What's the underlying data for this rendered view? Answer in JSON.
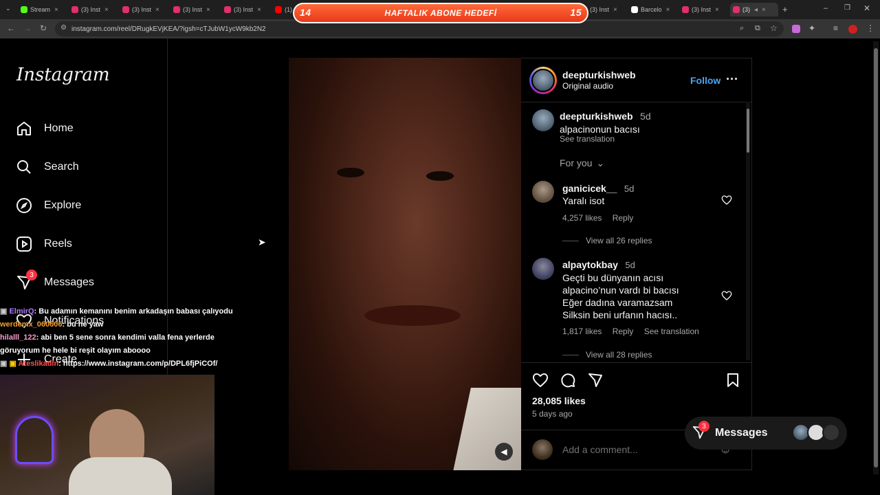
{
  "browser": {
    "tabs": [
      {
        "label": "Stream",
        "color": "#53fc18"
      },
      {
        "label": "(3) Inst",
        "color": "#e1306c"
      },
      {
        "label": "(3) Inst",
        "color": "#e1306c"
      },
      {
        "label": "(3) Inst",
        "color": "#e1306c"
      },
      {
        "label": "(3) Inst",
        "color": "#e1306c"
      },
      {
        "label": "(1)",
        "color": "#ff0000"
      },
      {
        "label": "(3) Inst",
        "color": "#e1306c"
      },
      {
        "label": "Barcelo",
        "color": "#ffffff"
      },
      {
        "label": "(3) Inst",
        "color": "#e1306c"
      },
      {
        "label": "(3)",
        "color": "#e1306c"
      }
    ],
    "url": "instagram.com/reel/DRugkEVjKEA/?igsh=cTJubW1ycW9kb2N2"
  },
  "banner": {
    "left_num": "14",
    "text": "HAFTALIK ABONE HEDEFİ",
    "right_num": "15"
  },
  "instagram": {
    "logo": "Instagram",
    "nav": {
      "home": "Home",
      "search": "Search",
      "explore": "Explore",
      "reels": "Reels",
      "messages": "Messages",
      "messages_badge": "3",
      "notifications": "Notifications",
      "create": "Create"
    },
    "post": {
      "author": "deepturkishweb",
      "audio": "Original audio",
      "follow": "Follow",
      "caption": {
        "user": "deepturkishweb",
        "time": "5d",
        "text": "alpacinonun bacısı",
        "translate": "See translation"
      },
      "filter": "For you",
      "comments": [
        {
          "user": "ganicicek__",
          "time": "5d",
          "lines": [
            "Yaralı isot"
          ],
          "likes": "4,257 likes",
          "reply": "Reply",
          "replies": "View all 26 replies"
        },
        {
          "user": "alpaytokbay",
          "time": "5d",
          "lines": [
            "Geçti bu dünyanın acısı",
            "alpacino’nun vardı bi bacısı",
            "Eğer dadına varamazsam",
            "Silksin beni urfanın hacısı.."
          ],
          "likes": "1,817 likes",
          "reply": "Reply",
          "translate": "See translation",
          "replies": "View all 28 replies"
        }
      ],
      "likes": "28,085 likes",
      "age": "5 days ago",
      "comment_placeholder": "Add a comment..."
    },
    "messages_pill": {
      "label": "Messages",
      "badge": "3"
    }
  },
  "chat": [
    {
      "user": "ElmirQ",
      "color": "#b07cff",
      "text": ": Bu adamın kemanını benim arkadaşın babası çalıyodu"
    },
    {
      "user": "werdemx_060606",
      "color": "#f0a030",
      "text": ": bu ne yaw"
    },
    {
      "user": "hilalll_122",
      "color": "#ff9ad0",
      "text": ": abi ben 5 sene sonra kendimi valla fena yerlerde"
    },
    {
      "user": "",
      "color": "#ffffff",
      "text": "göruyorum he hele bi reşit olayım aboooo"
    },
    {
      "user": "Ateslikadin",
      "color": "#ff5050",
      "text": ": https://www.instagram.com/p/DPL6fjPiCOf/"
    }
  ],
  "colors": {
    "accent": "#4aa5f5",
    "badge": "#ff3040"
  }
}
